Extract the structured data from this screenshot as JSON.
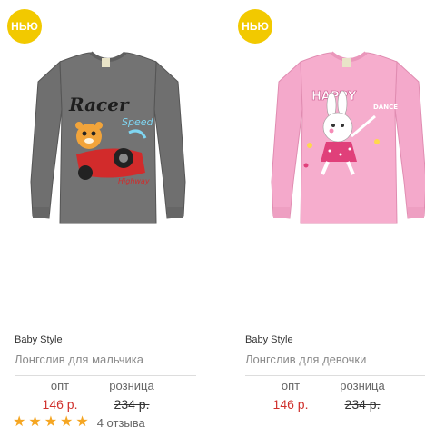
{
  "products": [
    {
      "badge": "НЬЮ",
      "image_alt": "Grey boys longsleeve with racer tiger print",
      "brand": "Baby Style",
      "name": "Лонгслив для мальчика",
      "opt_label": "опт",
      "opt_price": "146 р.",
      "retail_label": "розница",
      "retail_price": "234 р.",
      "rating": 5,
      "reviews": "4 отзыва",
      "shirt_color": "#6f6f6f"
    },
    {
      "badge": "НЬЮ",
      "image_alt": "Pink girls longsleeve with dancing bunny print",
      "brand": "Baby Style",
      "name": "Лонгслив для девочки",
      "opt_label": "опт",
      "opt_price": "146 р.",
      "retail_label": "розница",
      "retail_price": "234 р.",
      "shirt_color": "#f2a7c8"
    }
  ],
  "colors": {
    "badge": "#f2c900",
    "price_opt": "#d0312d",
    "star": "#f5a623"
  },
  "print_text": {
    "left": [
      "Racer",
      "Speed",
      "Highway"
    ],
    "right": [
      "HAPPY",
      "DANCE"
    ]
  }
}
